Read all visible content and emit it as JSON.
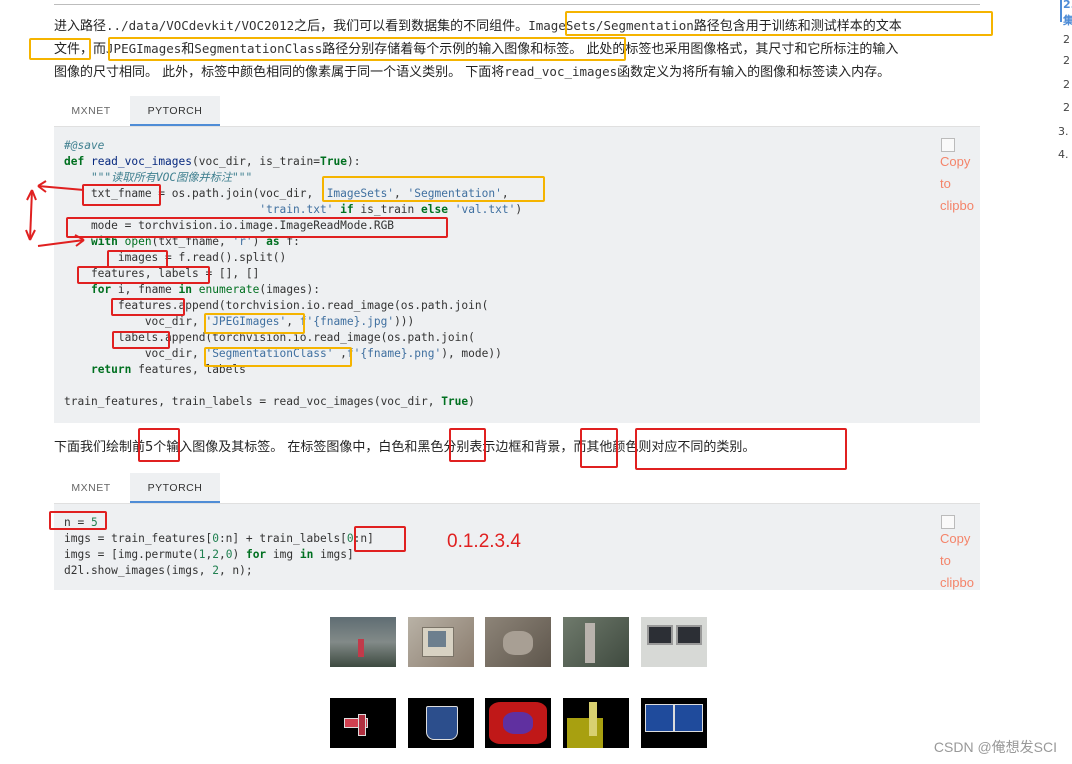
{
  "paragraph1": {
    "line1_a": "进入路径",
    "line1_code1": "../data/VOCdevkit/VOC2012",
    "line1_b": "之后，我们可以看到数据集的不同组件。",
    "line1_code2": "ImageSets/Segmentation",
    "line1_c": "路径包含用于训练和测试样本的文本",
    "line2_a": "文件，而",
    "line2_code1": "JPEGImages",
    "line2_b": "和",
    "line2_code2": "SegmentationClass",
    "line2_c": "路径分别存储着每个示例的输入图像和标签。 此处的标签也采用图像格式，其尺寸和它所标注的输入",
    "line3_a": "图像的尺寸相同。 此外，标签中颜色相同的像素属于同一个语义类别。 下面将",
    "line3_code": "read_voc_images",
    "line3_b": "函数定义为将所有输入的图像和标签读入内存。"
  },
  "tabs1": {
    "mxnet": "MXNET",
    "pytorch": "PYTORCH"
  },
  "code1": [
    "#@save",
    "def read_voc_images(voc_dir, is_train=True):",
    "    \"\"\"读取所有VOC图像并标注\"\"\"",
    "    txt_fname = os.path.join(voc_dir, 'ImageSets', 'Segmentation',",
    "                             'train.txt' if is_train else 'val.txt')",
    "    mode = torchvision.io.image.ImageReadMode.RGB",
    "    with open(txt_fname, 'r') as f:",
    "        images = f.read().split()",
    "    features, labels = [], []",
    "    for i, fname in enumerate(images):",
    "        features.append(torchvision.io.read_image(os.path.join(",
    "            voc_dir, 'JPEGImages', f'{fname}.jpg')))",
    "        labels.append(torchvision.io.read_image(os.path.join(",
    "            voc_dir, 'SegmentationClass' ,f'{fname}.png'), mode))",
    "    return features, labels",
    "",
    "train_features, train_labels = read_voc_images(voc_dir, True)"
  ],
  "copy_label": "Copy\nto\nclipbo",
  "paragraph2": "下面我们绘制前5个输入图像及其标签。 在标签图像中，白色和黑色分别表示边框和背景，而其他颜色则对应不同的类别。",
  "tabs2": {
    "mxnet": "MXNET",
    "pytorch": "PYTORCH"
  },
  "code2": [
    "n = 5",
    "imgs = train_features[0:n] + train_labels[0:n]",
    "imgs = [img.permute(1,2,0) for img in imgs]",
    "d2l.show_images(imgs, 2, n);"
  ],
  "annotation_text": "0.1.2.3.4",
  "toc": {
    "items": [
      "2.",
      "集",
      "2",
      "2",
      "2",
      "2",
      "3.",
      "4."
    ]
  },
  "watermark": "CSDN @俺想发SCI",
  "colors": {
    "highlight_yellow": "#f5b400",
    "highlight_red": "#e02020",
    "code_bg": "#eef0f2",
    "copy_text": "#f4846a"
  }
}
